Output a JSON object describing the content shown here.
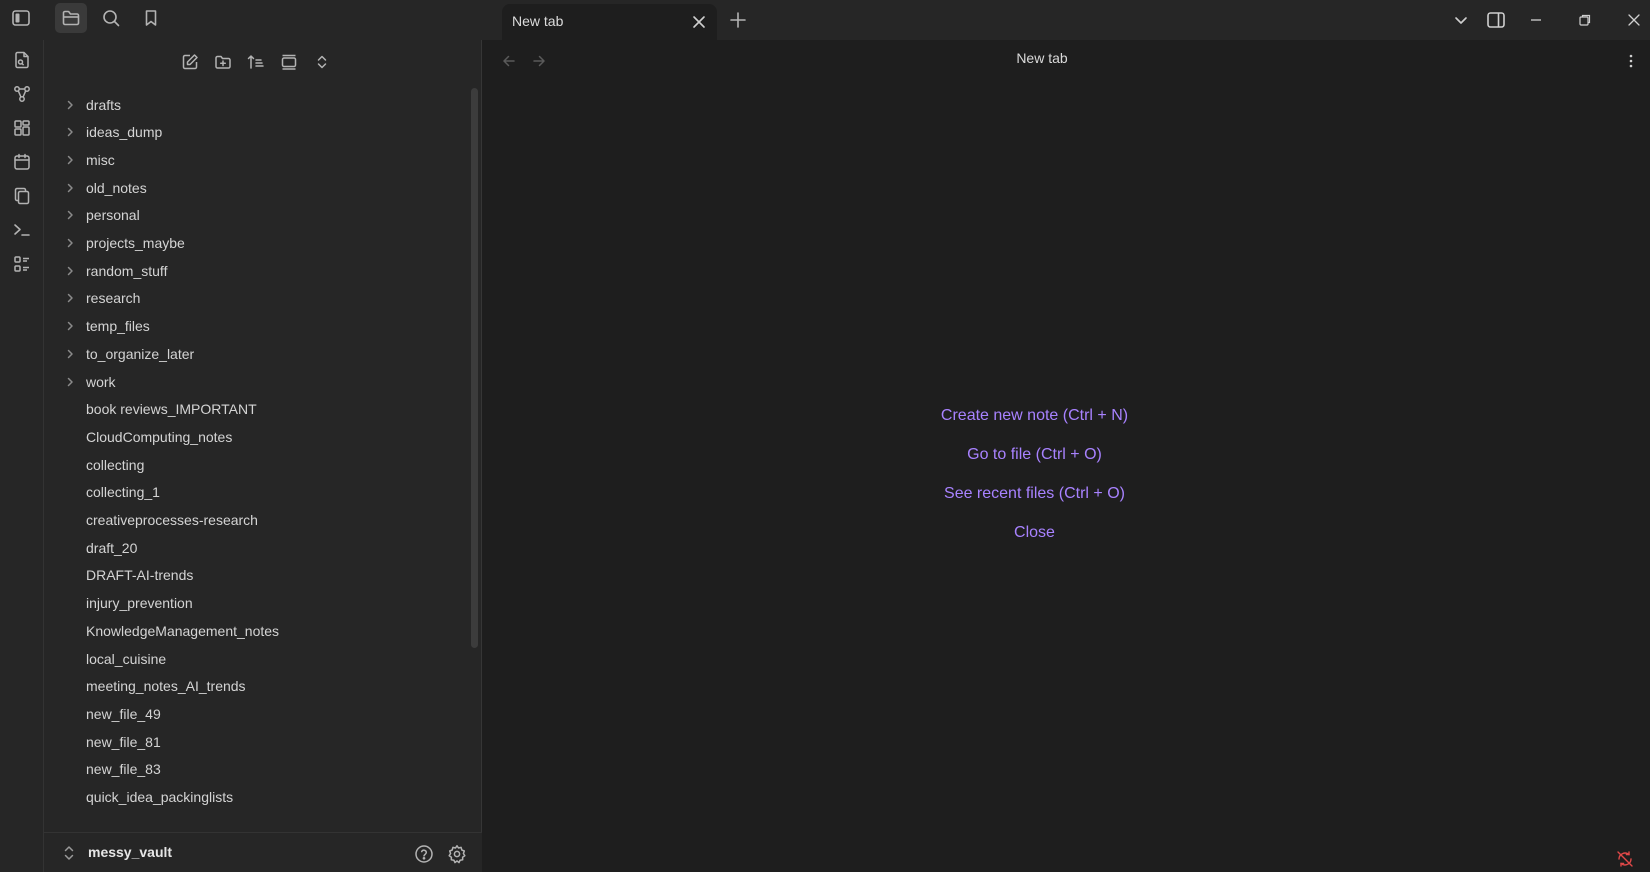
{
  "tab": {
    "title": "New tab"
  },
  "view": {
    "title": "New tab"
  },
  "sidebar": {
    "tree": [
      {
        "label": "drafts",
        "type": "folder"
      },
      {
        "label": "ideas_dump",
        "type": "folder"
      },
      {
        "label": "misc",
        "type": "folder"
      },
      {
        "label": "old_notes",
        "type": "folder"
      },
      {
        "label": "personal",
        "type": "folder"
      },
      {
        "label": "projects_maybe",
        "type": "folder"
      },
      {
        "label": "random_stuff",
        "type": "folder"
      },
      {
        "label": "research",
        "type": "folder"
      },
      {
        "label": "temp_files",
        "type": "folder"
      },
      {
        "label": "to_organize_later",
        "type": "folder"
      },
      {
        "label": "work",
        "type": "folder"
      },
      {
        "label": "book reviews_IMPORTANT",
        "type": "file"
      },
      {
        "label": "CloudComputing_notes",
        "type": "file"
      },
      {
        "label": "collecting",
        "type": "file"
      },
      {
        "label": "collecting_1",
        "type": "file"
      },
      {
        "label": "creativeprocesses-research",
        "type": "file"
      },
      {
        "label": "draft_20",
        "type": "file"
      },
      {
        "label": "DRAFT-AI-trends",
        "type": "file"
      },
      {
        "label": "injury_prevention",
        "type": "file"
      },
      {
        "label": "KnowledgeManagement_notes",
        "type": "file"
      },
      {
        "label": "local_cuisine",
        "type": "file"
      },
      {
        "label": "meeting_notes_AI_trends",
        "type": "file"
      },
      {
        "label": "new_file_49",
        "type": "file"
      },
      {
        "label": "new_file_81",
        "type": "file"
      },
      {
        "label": "new_file_83",
        "type": "file"
      },
      {
        "label": "quick_idea_packinglists",
        "type": "file"
      }
    ]
  },
  "vault": {
    "name": "messy_vault"
  },
  "empty_state": {
    "actions": [
      "Create new note (Ctrl + N)",
      "Go to file (Ctrl + O)",
      "See recent files (Ctrl + O)",
      "Close"
    ]
  },
  "colors": {
    "accent": "#a882ff",
    "background": "#1e1e1e",
    "panel": "#262626"
  }
}
